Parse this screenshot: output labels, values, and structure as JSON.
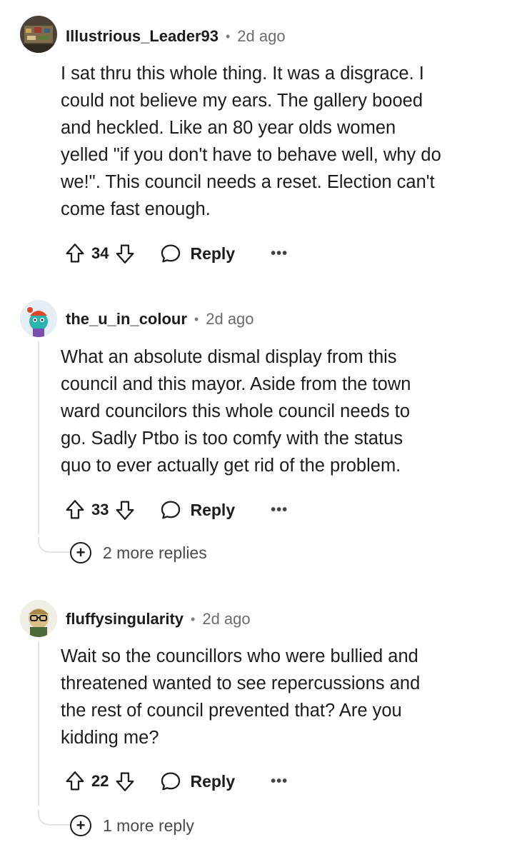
{
  "comments": [
    {
      "username": "Illustrious_Leader93",
      "separator": "•",
      "age": "2d ago",
      "body_lines": [
        "I sat thru this whole thing. It was a disgrace. I",
        "could not believe my ears. The gallery booed",
        "and heckled. Like an 80 year olds women",
        "yelled \"if you don't have to behave well, why do",
        "we!\". This council needs a reset. Election can't",
        "come fast enough."
      ],
      "score": "34",
      "reply_label": "Reply",
      "more_label": "•••",
      "more_replies": ""
    },
    {
      "username": "the_u_in_colour",
      "separator": "•",
      "age": "2d ago",
      "body_lines": [
        "What an absolute dismal display from this",
        "council and this mayor. Aside from the town",
        "ward councilors this whole council needs to",
        "go. Sadly Ptbo is too comfy with the status",
        "quo to ever actually get rid of the problem."
      ],
      "score": "33",
      "reply_label": "Reply",
      "more_label": "•••",
      "more_replies": "2 more replies"
    },
    {
      "username": "fluffysingularity",
      "separator": "•",
      "age": "2d ago",
      "body_lines": [
        "Wait so the councillors who were bullied and",
        "threatened wanted to see repercussions and",
        "the rest of council prevented that? Are you",
        "kidding me?"
      ],
      "score": "22",
      "reply_label": "Reply",
      "more_label": "•••",
      "more_replies": "1 more reply"
    }
  ],
  "icons": {
    "upvote": "arrow-up-outline-icon",
    "downvote": "arrow-down-outline-icon",
    "reply": "speech-bubble-icon",
    "expand": "plus-circle-icon"
  },
  "colors": {
    "text": "#1c1c1c",
    "meta": "#6b6b6b",
    "thread_line": "#e4e4e4"
  }
}
